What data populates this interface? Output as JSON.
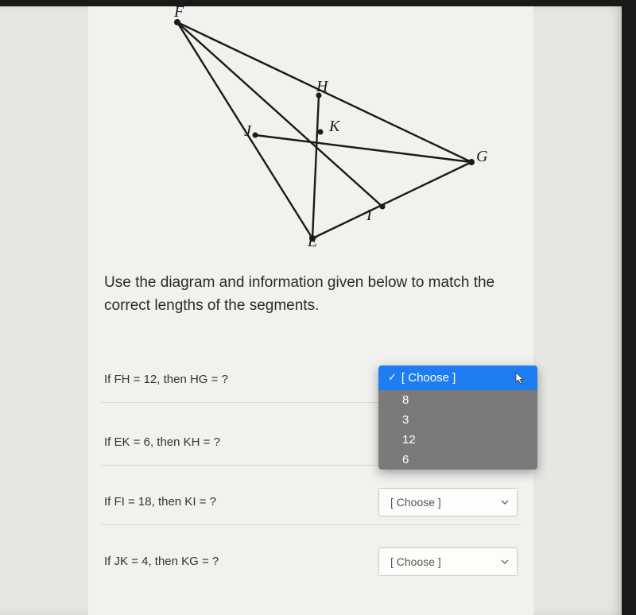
{
  "diagram": {
    "labels": {
      "F": "F",
      "H": "H",
      "K": "K",
      "G": "G",
      "I": "I",
      "J": "J",
      "E": "E"
    }
  },
  "instructions": "Use the diagram and information given below to match the correct lengths of the segments.",
  "rows": [
    {
      "prompt": "If FH = 12, then HG = ?",
      "placeholder": "[ Choose ]"
    },
    {
      "prompt": "If EK = 6, then KH = ?",
      "placeholder": "[ Choose ]"
    },
    {
      "prompt": "If FI = 18, then KI = ?",
      "placeholder": "[ Choose ]"
    },
    {
      "prompt": "If JK = 4, then KG = ?",
      "placeholder": "[ Choose ]"
    }
  ],
  "dropdown": {
    "selected": "[ Choose ]",
    "options": [
      "8",
      "3",
      "12",
      "6"
    ]
  }
}
